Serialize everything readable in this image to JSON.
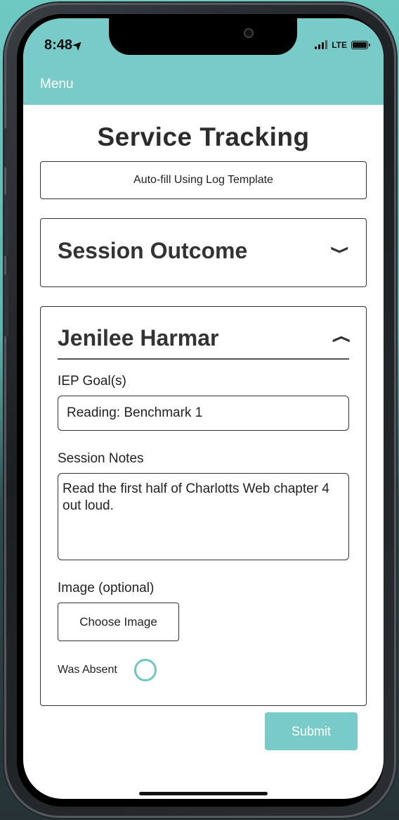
{
  "status_bar": {
    "time": "8:48",
    "network": "LTE"
  },
  "nav": {
    "menu_label": "Menu"
  },
  "page": {
    "title": "Service Tracking",
    "autofill_label": "Auto-fill Using Log Template"
  },
  "outcome_section": {
    "title": "Session Outcome",
    "expanded": false
  },
  "student_section": {
    "name": "Jenilee Harmar",
    "expanded": true,
    "iep_goal_label": "IEP Goal(s)",
    "iep_goal_value": "Reading: Benchmark 1",
    "notes_label": "Session Notes",
    "notes_value": "Read the first half of Charlotts Web chapter 4 out loud.",
    "image_label": "Image (optional)",
    "choose_image_label": "Choose Image",
    "absent_label": "Was Absent",
    "absent_checked": false
  },
  "actions": {
    "submit_label": "Submit"
  },
  "colors": {
    "accent": "#78cbc8",
    "radio_ring": "#6fc6c1",
    "text": "#333333"
  }
}
